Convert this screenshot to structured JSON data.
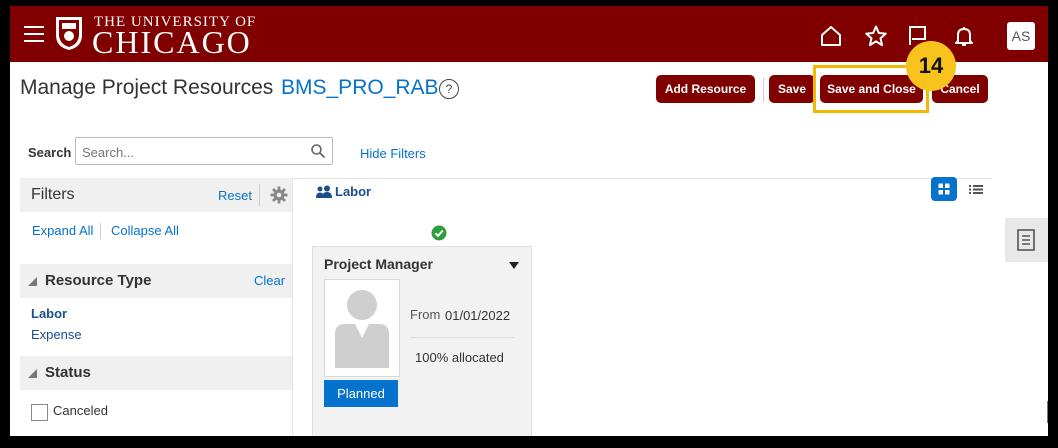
{
  "header": {
    "logo_top": "THE UNIVERSITY OF",
    "logo_main": "CHICAGO",
    "avatar_initials": "AS",
    "icons": [
      "menu-icon",
      "home-icon",
      "star-icon",
      "flag-icon",
      "bell-icon"
    ],
    "brand_color": "#800000"
  },
  "page": {
    "title": "Manage Project Resources",
    "project_name": "BMS_PRO_RAB",
    "help_symbol": "?"
  },
  "toolbar": {
    "add_resource": "Add Resource",
    "save": "Save",
    "save_and_close": "Save and Close",
    "cancel": "Cancel"
  },
  "annotation": {
    "step_number": "14",
    "highlight_color": "#f5b800"
  },
  "search": {
    "label": "Search",
    "placeholder": "Search...",
    "hide_filters": "Hide Filters"
  },
  "filters": {
    "title": "Filters",
    "reset": "Reset",
    "expand_all": "Expand All",
    "collapse_all": "Collapse All",
    "resource_type": {
      "title": "Resource Type",
      "clear": "Clear",
      "items": [
        {
          "label": "Labor",
          "selected": true
        },
        {
          "label": "Expense",
          "selected": false
        }
      ]
    },
    "status": {
      "title": "Status",
      "items": [
        {
          "label": "Canceled",
          "checked": false
        }
      ]
    }
  },
  "main": {
    "group_label": "Labor",
    "view_mode": "grid",
    "card": {
      "title": "Project Manager",
      "from_label": "From",
      "from_date": "01/01/2022",
      "allocation": "100% allocated",
      "status": "Planned",
      "status_color": "#0572ce",
      "confirmed_icon": "check-circle-icon"
    }
  }
}
